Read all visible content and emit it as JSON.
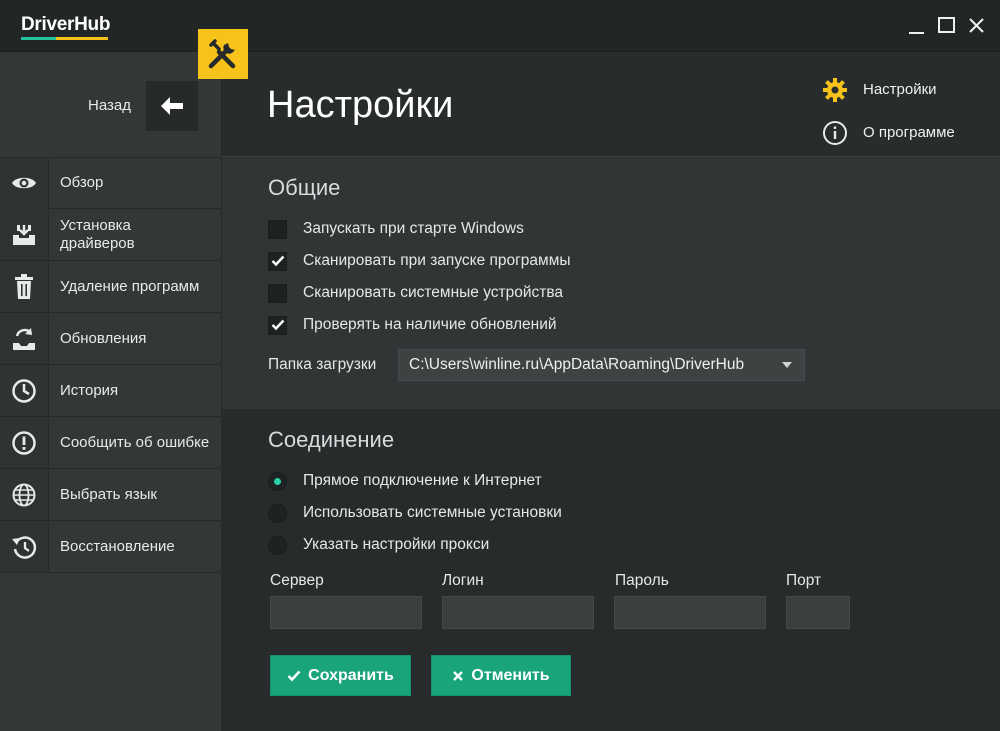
{
  "app": {
    "logo": "DriverHub",
    "brand_colors": {
      "teal": "#24c3a0",
      "yellow": "#f7c21a",
      "button": "#19a47b"
    }
  },
  "window_controls": [
    "minimize-icon",
    "maximize-icon",
    "close-icon"
  ],
  "header": {
    "back_label": "Назад",
    "title": "Настройки",
    "menu": [
      {
        "label": "Настройки",
        "icon": "gear-icon"
      },
      {
        "label": "О программе",
        "icon": "info-icon"
      }
    ]
  },
  "sidebar": {
    "items": [
      {
        "label": "Обзор",
        "icon": "eye-icon"
      },
      {
        "label": "Установка драйверов",
        "icon": "install-icon"
      },
      {
        "label": "Удаление программ",
        "icon": "trash-icon"
      },
      {
        "label": "Обновления",
        "icon": "update-icon"
      },
      {
        "label": "История",
        "icon": "clock-icon"
      },
      {
        "label": "Сообщить об ошибке",
        "icon": "alert-icon"
      },
      {
        "label": "Выбрать язык",
        "icon": "globe-icon"
      },
      {
        "label": "Восстановление",
        "icon": "restore-icon"
      }
    ]
  },
  "general": {
    "title": "Общие",
    "options": [
      {
        "label": "Запускать при старте Windows",
        "checked": false
      },
      {
        "label": "Сканировать при запуске программы",
        "checked": true
      },
      {
        "label": "Сканировать системные устройства",
        "checked": false
      },
      {
        "label": "Проверять на наличие обновлений",
        "checked": true
      }
    ],
    "folder_label": "Папка загрузки",
    "folder_value": "C:\\Users\\winline.ru\\AppData\\Roaming\\DriverHub"
  },
  "connection": {
    "title": "Соединение",
    "options": [
      {
        "label": "Прямое подключение к Интернет",
        "selected": true
      },
      {
        "label": "Использовать системные установки",
        "selected": false
      },
      {
        "label": "Указать настройки прокси",
        "selected": false
      }
    ],
    "fields": {
      "server": {
        "label": "Сервер",
        "value": ""
      },
      "login": {
        "label": "Логин",
        "value": ""
      },
      "password": {
        "label": "Пароль",
        "value": ""
      },
      "port": {
        "label": "Порт",
        "value": ""
      }
    }
  },
  "buttons": {
    "save": "Сохранить",
    "cancel": "Отменить"
  }
}
